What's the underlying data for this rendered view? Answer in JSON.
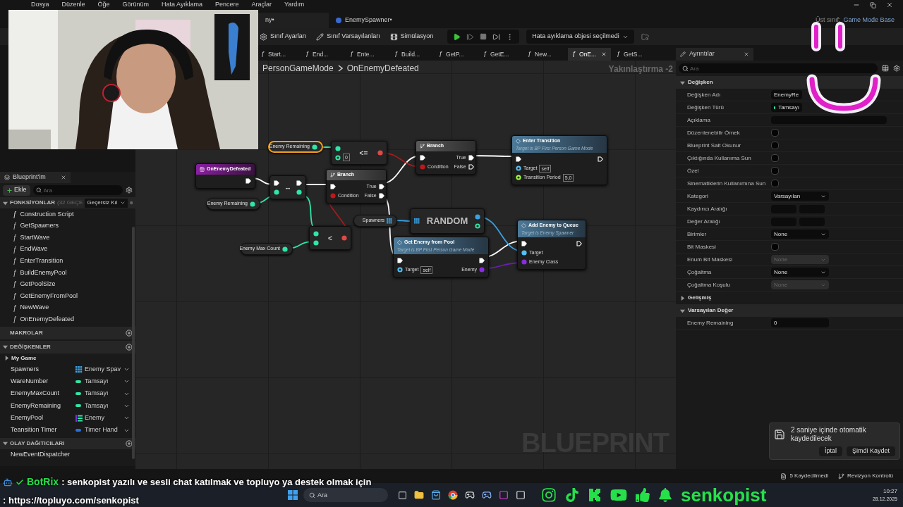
{
  "menu": [
    "Dosya",
    "Düzenle",
    "Öğe",
    "Görünüm",
    "Hata Ayıklama",
    "Pencere",
    "Araçlar",
    "Yardım"
  ],
  "document_tabs": [
    {
      "label": "ny•",
      "selected": true
    },
    {
      "label": "EnemySpawner•",
      "selected": false
    }
  ],
  "parent_class": {
    "label": "Üst sınıf:",
    "value": "Game Mode Base"
  },
  "toolbar": {
    "buttons": [
      {
        "kind": "settings",
        "label": "Sınıf Ayarları"
      },
      {
        "kind": "defaults",
        "label": "Sınıf Varsayılanları"
      },
      {
        "kind": "simulation",
        "label": "Simülasyon"
      }
    ],
    "debug_object": "Hata ayıklama objesi seçilmedi"
  },
  "graph_tabs": [
    {
      "glyph": "ƒ",
      "label": "Start...",
      "selected": false
    },
    {
      "glyph": "ƒ",
      "label": "End...",
      "selected": false
    },
    {
      "glyph": "ƒ",
      "label": "Ente...",
      "selected": false
    },
    {
      "glyph": "ƒ",
      "label": "Build...",
      "selected": false
    },
    {
      "glyph": "ƒ",
      "label": "GetP...",
      "selected": false
    },
    {
      "glyph": "ƒ",
      "label": "GetE...",
      "selected": false
    },
    {
      "glyph": "ƒ",
      "label": "New...",
      "selected": false
    },
    {
      "glyph": "ƒ",
      "label": "OnE...",
      "selected": true
    },
    {
      "glyph": "ƒ",
      "label": "GetS...",
      "selected": false
    }
  ],
  "breadcrumb": [
    "PersonGameMode",
    "OnEnemyDefeated"
  ],
  "zoom": "Yakınlaştırma -2",
  "my_blueprint": {
    "title": "Blueprint'im",
    "add_button": "Ekle",
    "search_placeholder": "Ara",
    "functions": {
      "title": "FONKSİYONLAR",
      "count": "(32 GEÇE",
      "override": "Geçersiz Kıl",
      "expanded": true,
      "items": [
        {
          "glyph": "ƒ",
          "label": "Construction Script",
          "kind": "construction"
        },
        {
          "glyph": "ƒ",
          "label": "GetSpawners",
          "kind": "function"
        },
        {
          "glyph": "ƒ",
          "label": "StartWave",
          "kind": "function"
        },
        {
          "glyph": "ƒ",
          "label": "EndWave",
          "kind": "function"
        },
        {
          "glyph": "ƒ",
          "label": "EnterTransition",
          "kind": "function"
        },
        {
          "glyph": "ƒ",
          "label": "BuildEnemyPool",
          "kind": "function"
        },
        {
          "glyph": "ƒ",
          "label": "GetPoolSize",
          "kind": "function"
        },
        {
          "glyph": "ƒ",
          "label": "GetEnemyFromPool",
          "kind": "function"
        },
        {
          "glyph": "ƒ",
          "label": "NewWave",
          "kind": "function"
        },
        {
          "glyph": "ƒ",
          "label": "OnEnemyDefeated",
          "kind": "function"
        }
      ]
    },
    "macros": {
      "title": "MAKROLAR"
    },
    "variables": {
      "title": "DEĞİŞKENLER",
      "expanded": true,
      "category": "My Game",
      "category_expanded": false,
      "items": [
        {
          "name": "Spawners",
          "type": "Enemy Spav",
          "kind": "array",
          "color": "#3aa0e0"
        },
        {
          "name": "WareNumber",
          "type": "Tamsayı",
          "kind": "single",
          "color": "#2ee6a6"
        },
        {
          "name": "EnemyMaxCount",
          "type": "Tamsayı",
          "kind": "single",
          "color": "#2ee6a6"
        },
        {
          "name": "EnemyRemaining",
          "type": "Tamsayı",
          "kind": "single",
          "color": "#2ee6a6"
        },
        {
          "name": "EnemyPool",
          "type": "Enemy",
          "kind": "list",
          "color": "#2ee6a6"
        },
        {
          "name": "Teansition Timer",
          "type": "Timer Hand",
          "kind": "single",
          "color": "#2a6fd6"
        }
      ]
    },
    "dispatchers": {
      "title": "OLAY DAĞITICILARI",
      "expanded": true,
      "items": [
        "NewEventDispatcher"
      ]
    }
  },
  "nodes": [
    {
      "kind": "getter",
      "label": "Enemy Remaining",
      "selected": true,
      "pin": {
        "kind": "data",
        "color": "#2ee6a6",
        "connected": true
      }
    },
    {
      "kind": "operator",
      "symbol": "<=",
      "inputs": [
        {
          "kind": "data",
          "color": "#2ee6a6",
          "connected": true
        },
        {
          "kind": "data",
          "color": "#2ee6a6",
          "connected": false,
          "value": "0"
        }
      ],
      "outputs": [
        {
          "kind": "data",
          "color": "#e04848",
          "connected": true
        }
      ]
    },
    {
      "kind": "event",
      "title": "OnEnemyDefeated",
      "outputs": [
        {
          "kind": "exec",
          "connected": true
        }
      ]
    },
    {
      "kind": "operator",
      "symbol": "--",
      "inputs": [
        {
          "kind": "exec",
          "connected": true
        },
        {
          "kind": "data",
          "color": "#2ee6a6",
          "connected": true
        }
      ],
      "outputs": [
        {
          "kind": "exec",
          "connected": true
        },
        {
          "kind": "data",
          "color": "#2ee6a6",
          "connected": true
        }
      ]
    },
    {
      "kind": "branch",
      "title": "Branch",
      "inputs": [
        {
          "kind": "exec",
          "connected": true
        },
        {
          "kind": "data",
          "color": "#c01818",
          "connected": true,
          "label": "Condition"
        }
      ],
      "outputs": [
        {
          "kind": "exec",
          "connected": true,
          "label": "True"
        },
        {
          "kind": "exec",
          "connected": true,
          "label": "False"
        }
      ]
    },
    {
      "kind": "branch",
      "title": "Branch",
      "inputs": [
        {
          "kind": "exec",
          "connected": true
        },
        {
          "kind": "data",
          "color": "#c01818",
          "connected": true,
          "label": "Condition"
        }
      ],
      "outputs": [
        {
          "kind": "exec",
          "connected": true,
          "label": "True"
        },
        {
          "kind": "exec",
          "connected": false,
          "label": "False"
        }
      ]
    },
    {
      "kind": "function",
      "title": "Enter Transition",
      "subtitle": "Target is BP First Person Game Mode",
      "inputs": [
        {
          "kind": "exec",
          "connected": true
        },
        {
          "kind": "data",
          "color": "#4fc3f7",
          "connected": false,
          "label": "Target",
          "value": "self"
        },
        {
          "kind": "data",
          "color": "#9cff3f",
          "connected": false,
          "label": "Transition Period",
          "value": "5,0"
        }
      ],
      "outputs": [
        {
          "kind": "exec",
          "connected": false
        }
      ]
    },
    {
      "kind": "getter",
      "label": "Enemy Remaining",
      "selected": false,
      "pin": {
        "kind": "data",
        "color": "#2ee6a6",
        "connected": true
      }
    },
    {
      "kind": "getter",
      "label": "Spawners",
      "selected": false,
      "pin": {
        "kind": "array",
        "color": "#3aa0e0",
        "connected": true
      }
    },
    {
      "kind": "macro",
      "title": "RANDOM",
      "inputs": [
        {
          "kind": "array",
          "color": "#3aa0e0",
          "connected": true
        }
      ],
      "outputs": [
        {
          "kind": "data",
          "color": "#3aa0e0",
          "connected": true
        },
        {
          "kind": "data",
          "color": "#2ee6a6",
          "connected": false
        }
      ]
    },
    {
      "kind": "operator",
      "symbol": "<",
      "inputs": [
        {
          "kind": "data",
          "color": "#2ee6a6",
          "connected": true
        },
        {
          "kind": "data",
          "color": "#2ee6a6",
          "connected": true
        }
      ],
      "outputs": [
        {
          "kind": "data",
          "color": "#e04848",
          "connected": true
        }
      ]
    },
    {
      "kind": "getter",
      "label": "Enemy Max Count",
      "selected": false,
      "pin": {
        "kind": "data",
        "color": "#2ee6a6",
        "connected": true
      }
    },
    {
      "kind": "function",
      "title": "Get Enemy from Pool",
      "subtitle": "Target is BP First Person Game Mode",
      "inputs": [
        {
          "kind": "exec",
          "connected": true
        },
        {
          "kind": "data",
          "color": "#4fc3f7",
          "connected": false,
          "label": "Target",
          "value": "self"
        }
      ],
      "outputs": [
        {
          "kind": "exec",
          "connected": true
        },
        {
          "kind": "data",
          "color": "#8a2be2",
          "connected": true,
          "label": "Enemy"
        }
      ]
    },
    {
      "kind": "function",
      "title": "Add Enemy to Queue",
      "subtitle": "Target is Enemy Spawner",
      "inputs": [
        {
          "kind": "exec",
          "connected": true
        },
        {
          "kind": "data",
          "color": "#4fc3f7",
          "connected": true,
          "label": "Target"
        },
        {
          "kind": "data",
          "color": "#8a2be2",
          "connected": true,
          "label": "Enemy Class"
        }
      ],
      "outputs": [
        {
          "kind": "exec",
          "connected": false
        }
      ]
    }
  ],
  "watermark": "BLUEPRINT",
  "details": {
    "title": "Ayrıntılar",
    "search_placeholder": "Ara",
    "sections": [
      {
        "title": "Değişken",
        "expanded": true,
        "rows": [
          {
            "label": "Değişken Adı",
            "kind": "text",
            "value": "EnemyRe"
          },
          {
            "label": "Değişken Türü",
            "kind": "type",
            "value": "Tamsayı",
            "color": "#2ee6a6"
          },
          {
            "label": "Açıklama",
            "kind": "textarea"
          },
          {
            "label": "Düzenlenebilir Örnek",
            "kind": "checkbox",
            "checked": false
          },
          {
            "label": "Blueprint Salt Okunur",
            "kind": "checkbox",
            "checked": false
          },
          {
            "label": "Çıktığında Kullanıma Sun",
            "kind": "checkbox",
            "checked": false
          },
          {
            "label": "Özel",
            "kind": "checkbox",
            "checked": false
          },
          {
            "label": "Sinematiklerin Kullanımına Sun",
            "kind": "checkbox",
            "checked": false
          },
          {
            "label": "Kategori",
            "kind": "combo",
            "value": "Varsayılan",
            "disabled": false
          },
          {
            "label": "Kaydırıcı Aralığı",
            "kind": "range"
          },
          {
            "label": "Değer Aralığı",
            "kind": "range"
          },
          {
            "label": "Birimler",
            "kind": "combo",
            "value": "None",
            "disabled": false
          },
          {
            "label": "Bit Maskesi",
            "kind": "checkbox",
            "checked": false
          },
          {
            "label": "Enum Bit Maskesi",
            "kind": "combo",
            "value": "None",
            "disabled": true
          },
          {
            "label": "Çoğaltma",
            "kind": "combo",
            "value": "None",
            "disabled": false
          },
          {
            "label": "Çoğaltma Koşulu",
            "kind": "combo",
            "value": "None",
            "disabled": true
          }
        ]
      },
      {
        "title": "Gelişmiş",
        "expanded": false
      },
      {
        "title": "Varsayılan Değer",
        "expanded": true,
        "rows": [
          {
            "label": "Enemy Remaining",
            "kind": "text",
            "value": "0"
          }
        ]
      }
    ]
  },
  "autosave": {
    "message": "2 saniye içinde otomatik kaydedilecek",
    "buttons": [
      "İptal",
      "Şimdi Kaydet"
    ]
  },
  "status_bar": [
    {
      "kind": "unsaved",
      "label": "5 Kaydedilmedi"
    },
    {
      "kind": "revision",
      "label": "Revizyon Kontrolü"
    }
  ],
  "stream_chat": {
    "user": "BotRix",
    "message": ": senkopist yazılı ve sesli chat katılmak ve topluyo ya destek olmak için",
    "link": ": https://topluyo.com/senkopist"
  },
  "taskbar": {
    "search_placeholder": "Ara",
    "channel": "senkopist",
    "time": "10:27",
    "date": "28.12.2025"
  }
}
